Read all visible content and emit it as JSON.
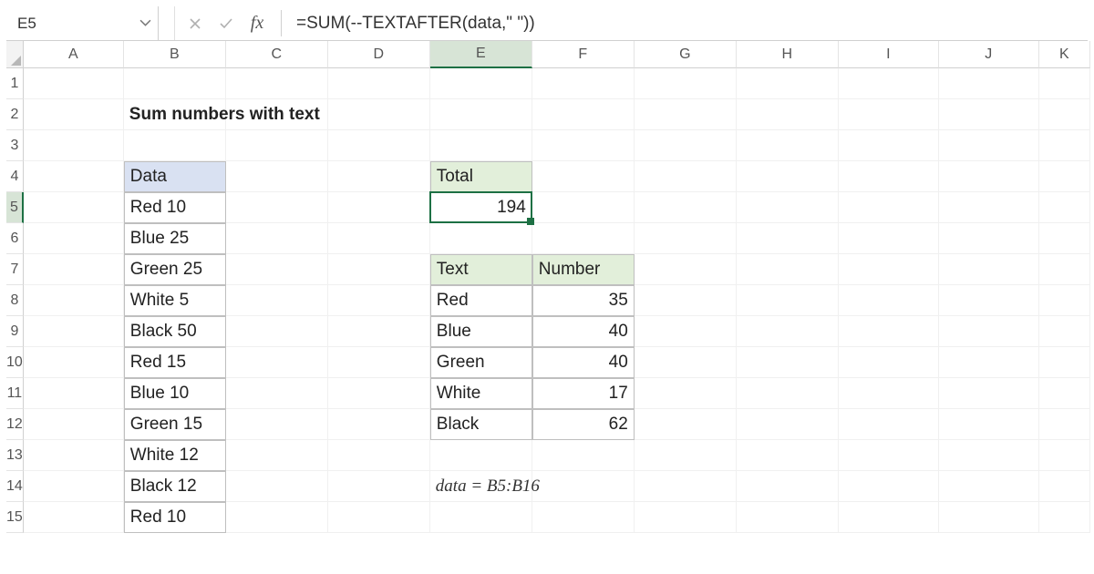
{
  "formula_bar": {
    "cell_ref": "E5",
    "formula": "=SUM(--TEXTAFTER(data,\" \"))"
  },
  "columns": [
    "A",
    "B",
    "C",
    "D",
    "E",
    "F",
    "G",
    "H",
    "I",
    "J",
    "K"
  ],
  "rows_visible": 15,
  "selected": {
    "col": "E",
    "row": 5
  },
  "title": "Sum numbers with text",
  "data_header": "Data",
  "data_values": [
    "Red 10",
    "Blue 25",
    "Green 25",
    "White 5",
    "Black 50",
    "Red 15",
    "Blue 10",
    "Green 15",
    "White 12",
    "Black 12",
    "Red 10"
  ],
  "total": {
    "label": "Total",
    "value": "194"
  },
  "summary": {
    "headers": [
      "Text",
      "Number"
    ],
    "rows": [
      {
        "text": "Red",
        "number": "35"
      },
      {
        "text": "Blue",
        "number": "40"
      },
      {
        "text": "Green",
        "number": "40"
      },
      {
        "text": "White",
        "number": "17"
      },
      {
        "text": "Black",
        "number": "62"
      }
    ]
  },
  "note": "data = B5:B16"
}
